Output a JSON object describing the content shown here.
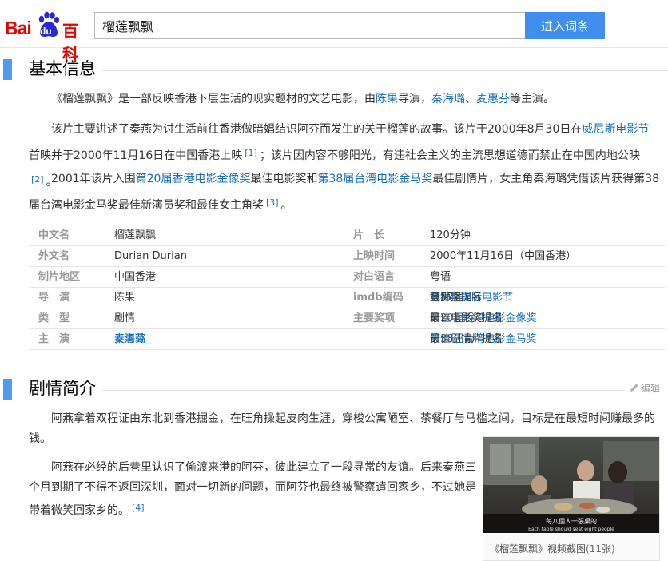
{
  "header": {
    "logo_bai": "Bai",
    "logo_du": "du",
    "logo_baike": "百科",
    "search_value": "榴莲飘飘",
    "search_button": "进入词条"
  },
  "sections": {
    "basic_title": "基本信息",
    "plot_title": "剧情简介",
    "edit_label": "编辑"
  },
  "intro": {
    "p1": {
      "a": "《榴莲飘飘》是一部反映香港下层生活的现实题材的文艺电影，由",
      "link_director": "陈果",
      "b": "导演，",
      "link_actor1": "秦海璐",
      "sep": "、",
      "link_actor2": "麦惠芬",
      "c": "等主演。"
    },
    "p2": {
      "a": "该片主要讲述了秦燕为讨生活前往香港做暗娼结识阿芬而发生的关于榴莲的故事。该片于2000年8月30日在",
      "link_festival": "威尼斯电影节",
      "b": "首映并于2000年11月16日在中国香港上映",
      "ref1": "[1]",
      "c": "；该片因内容不够阳光，有违社会主义的主流思想道德而禁止在中国内地公映",
      "ref2": "[2]",
      "d": "。"
    },
    "p3": {
      "a": "2001年该片入围",
      "link_hkfa": "第20届香港电影金像奖",
      "b": "最佳电影奖和",
      "link_ghh": "第38届台湾电影金马奖",
      "c": "最佳剧情片，女主角秦海璐凭借该片获得第38届台湾电影金马奖最佳新演员奖和最佳女主角奖",
      "ref3": "[3]",
      "d": "。"
    }
  },
  "info_table": {
    "r1": {
      "k1": "中文名",
      "v1": "榴莲飘飘",
      "k2": "片　长",
      "v2": "120分钟"
    },
    "r2": {
      "k1": "外文名",
      "v1": "Durian Durian",
      "k2": "上映时间",
      "v2": "2000年11月16日（中国香港）"
    },
    "r3": {
      "k1": "制片地区",
      "v1": "中国香港",
      "k2": "对白语言",
      "v2": "粤语"
    },
    "r4": {
      "k1": "导　演",
      "v1": "陈果",
      "k2": "imdb编码",
      "v2_a": "第57届",
      "v2_link": "威尼斯国际电影节",
      "v2_b": "金狮奖提名"
    },
    "r5": {
      "k1": "类　型",
      "v1": "剧情",
      "k2": "主要奖项",
      "v2_link": "第20届香港电影金像奖",
      "v2_b": "最佳电影奖提名"
    },
    "r6": {
      "k1": "主　演",
      "v1_a": "秦海璐",
      "v1_sep": "，",
      "v1_b": "麦惠芬",
      "v2_link": "第38届台湾电影金马奖",
      "v2_b": "最佳剧情片提名"
    }
  },
  "plot": {
    "p1": "阿燕拿着双程证由东北到香港掘金，在旺角操起皮肉生涯，穿梭公寓陋室、茶餐厅与马槛之间，目标是在最短时间赚最多的钱。",
    "p2": "阿燕在必经的后巷里认识了偷渡来港的阿芬，彼此建立了一段寻常的友谊。后来秦燕三个月到期了不得不返回深圳，面对一切新的问题，而阿芬也最终被警察遣回家乡，不过她是带着微笑回家乡的。",
    "ref4": "[4]"
  },
  "figure": {
    "subtitle_cn": "每八個人一張桌的",
    "subtitle_en": "Each table should seat eight people",
    "caption": "《榴莲飘飘》视频截图",
    "count": "(11张)"
  },
  "colors": {
    "brand_red": "#e10601",
    "accent_blue": "#3f8ef0",
    "link_blue": "#136ec2",
    "section_bar": "#4f9cee"
  }
}
